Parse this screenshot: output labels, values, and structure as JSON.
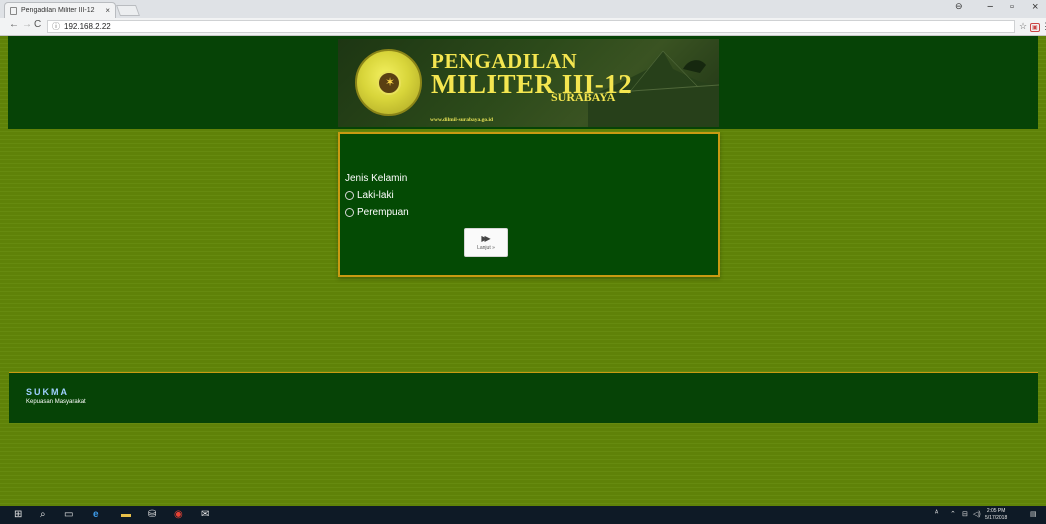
{
  "browser": {
    "tab_title": "Pengadilan Militer III-12",
    "tab_close": "×",
    "address": "192.168.2.22",
    "window_minimize": "−",
    "window_restore": "▫",
    "window_close": "×"
  },
  "banner": {
    "title_line1": "PENGADILAN",
    "title_line2": "MILITER III-12",
    "title_line3": "SURABAYA",
    "url": "www.dilmil-surabaya.go.id"
  },
  "form": {
    "question": "Jenis Kelamin",
    "options": [
      "Laki-laki",
      "Perempuan"
    ],
    "submit_label": "Lanjut »",
    "submit_icon": "fast-forward-icon"
  },
  "footer": {
    "title": "SUKMA",
    "subtitle": "Kepuasan Masyarakat"
  },
  "taskbar": {
    "time": "2:05 PM",
    "date": "5/17/2018"
  },
  "colors": {
    "page_bg": "#5f8208",
    "header_bg": "#064306",
    "form_bg": "#044a04",
    "accent_border": "#c99a12",
    "banner_text": "#f4e650"
  }
}
